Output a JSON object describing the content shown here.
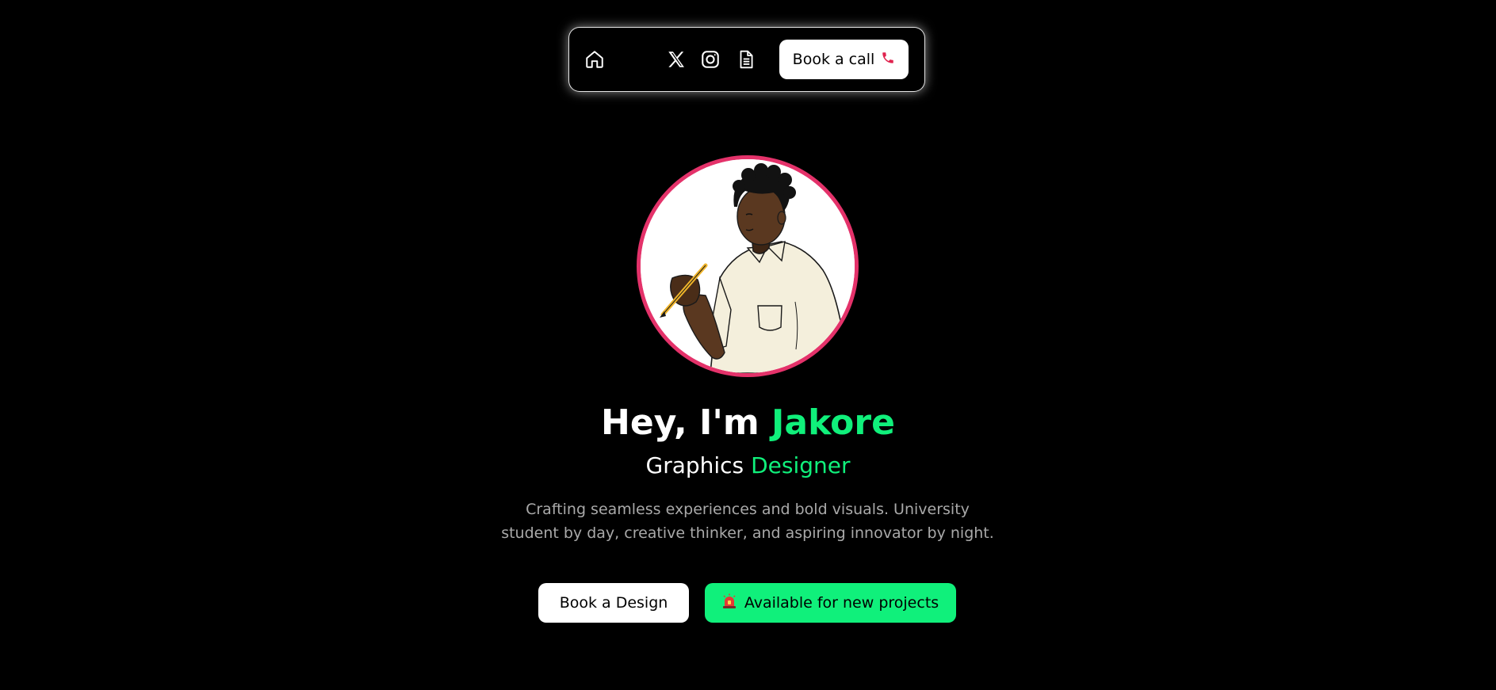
{
  "nav": {
    "icons": [
      "home-icon",
      "x-twitter-icon",
      "instagram-icon",
      "document-icon"
    ],
    "book_call_label": "Book a call",
    "book_call_icon": "phone-icon"
  },
  "hero": {
    "greeting": "Hey, I'm ",
    "name": "Jakore",
    "role_prefix": "Graphics ",
    "role_accent": "Designer",
    "description": "Crafting seamless experiences and bold visuals. University student by day, creative thinker, and aspiring innovator by night."
  },
  "actions": {
    "book_design_label": "Book a Design",
    "available_label": "Available for new projects",
    "available_icon": "siren-icon"
  },
  "colors": {
    "background": "#000000",
    "accent": "#10f07b",
    "avatar_ring": "#e4326a",
    "phone_icon": "#e0234e",
    "description_text": "#a9a9a9"
  }
}
